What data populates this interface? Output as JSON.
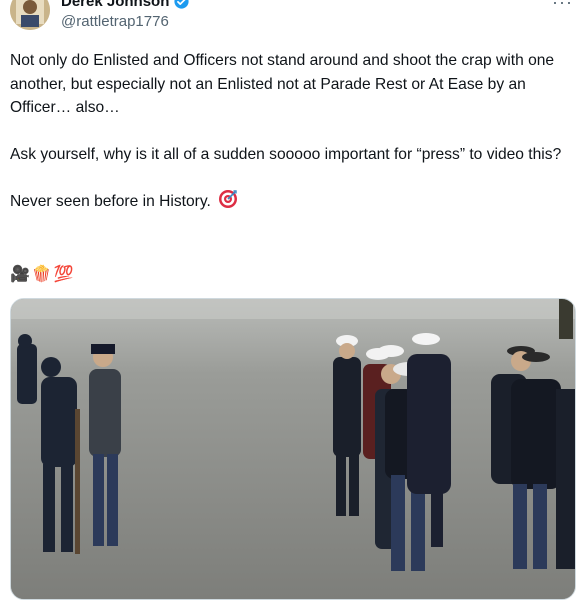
{
  "author": {
    "display_name": "Derek Johnson",
    "handle": "@rattletrap1776"
  },
  "tweet": {
    "paragraphs": [
      "Not only do Enlisted and Officers not stand around and shoot the crap with one another, but especially not an Enlisted not at Parade Rest or At Ease by an Officer… also…",
      "Ask yourself, why is it all of a sudden sooooo important for “press” to video this?",
      "Never seen before in History."
    ],
    "emojis": [
      "🎥",
      "🍿",
      "💯"
    ]
  },
  "colors": {
    "verified": "#1d9bf0",
    "text": "#0f1419",
    "secondary": "#536471",
    "tarmac": "#8a8a86"
  }
}
